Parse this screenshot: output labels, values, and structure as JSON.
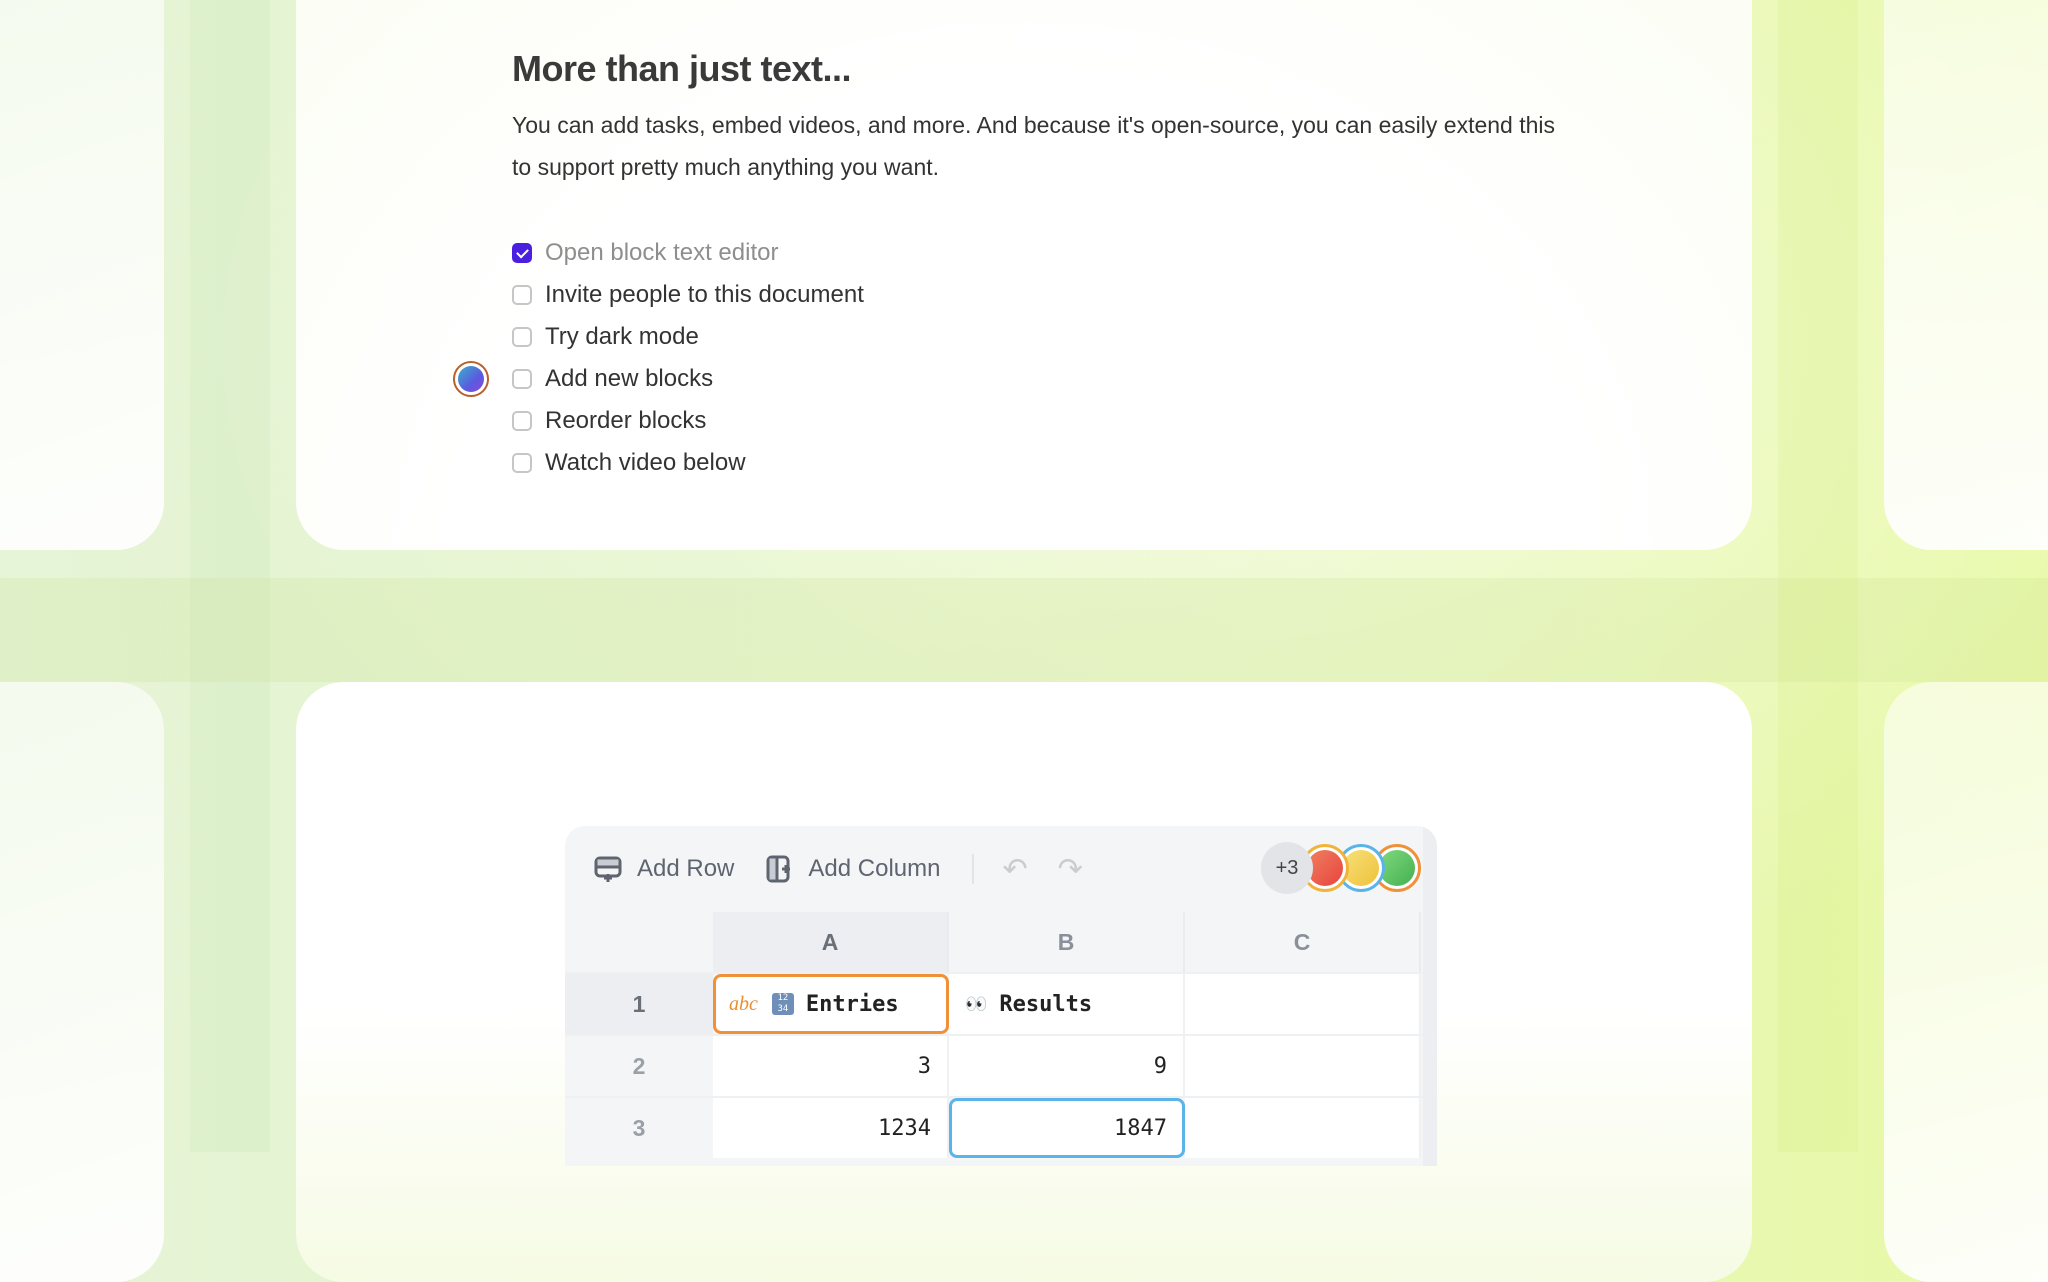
{
  "section": {
    "title": "More than just text...",
    "description": "You can add tasks, embed videos, and more. And because it's open-source, you can easily extend this to support pretty much anything you want."
  },
  "checklist": [
    {
      "label": "Open block text editor",
      "checked": true
    },
    {
      "label": "Invite people to this document",
      "checked": false
    },
    {
      "label": "Try dark mode",
      "checked": false
    },
    {
      "label": "Add new blocks",
      "checked": false
    },
    {
      "label": "Reorder blocks",
      "checked": false
    },
    {
      "label": "Watch video below",
      "checked": false
    }
  ],
  "cursor_avatar": {
    "icon": "user-avatar-icon",
    "ring_color": "#b8602e"
  },
  "spreadsheet": {
    "toolbar": {
      "add_row_label": "Add Row",
      "add_column_label": "Add Column",
      "undo_icon": "undo-icon",
      "redo_icon": "redo-icon"
    },
    "collaborators": {
      "more_count": "+3",
      "avatars": [
        {
          "name": "collaborator-red",
          "fill": "#ef5a4a",
          "ring": "#f2b33a"
        },
        {
          "name": "collaborator-yellow",
          "fill": "#f4cf48",
          "ring": "#5ab4ea"
        },
        {
          "name": "collaborator-green",
          "fill": "#5cc565",
          "ring": "#f0913a"
        }
      ]
    },
    "columns": [
      "A",
      "B",
      "C"
    ],
    "rows": [
      {
        "num": "1",
        "cells": [
          {
            "type_tag": "abc",
            "emoji": "🔢",
            "text": "Entries",
            "header": true
          },
          {
            "emoji": "👀",
            "text": "Results",
            "header": true
          },
          {
            "text": ""
          }
        ]
      },
      {
        "num": "2",
        "cells": [
          {
            "text": "3"
          },
          {
            "text": "9"
          },
          {
            "text": ""
          }
        ]
      },
      {
        "num": "3",
        "cells": [
          {
            "text": "1234"
          },
          {
            "text": "1847"
          },
          {
            "text": ""
          }
        ]
      }
    ],
    "selected_cells": {
      "orange": "A1",
      "blue": "B3"
    },
    "colors": {
      "accent_check": "#4a1fe0",
      "orange_selection": "#f0913a",
      "blue_selection": "#5ab4ea"
    }
  }
}
